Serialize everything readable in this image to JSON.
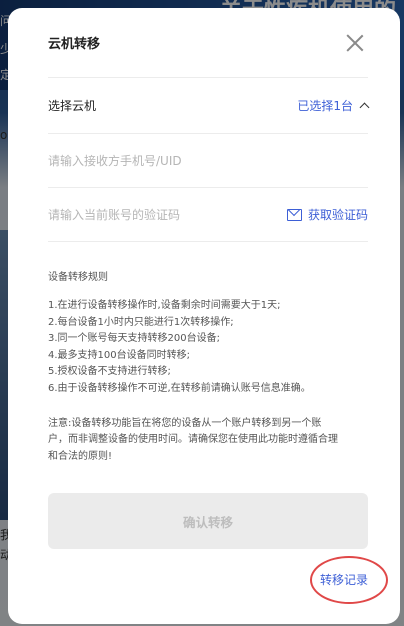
{
  "background": {
    "banner_text": "关于性疾机使用的",
    "left_fragments": [
      "问",
      "少",
      "定",
      "o",
      "我",
      "动"
    ]
  },
  "modal": {
    "title": "云机转移",
    "select_device": {
      "label": "选择云机",
      "value": "已选择1台"
    },
    "phone_input": {
      "placeholder": "请输入接收方手机号/UID",
      "value": ""
    },
    "code_input": {
      "placeholder": "请输入当前账号的验证码",
      "value": ""
    },
    "get_code_label": "获取验证码",
    "rules_title": "设备转移规则",
    "rules": [
      "1.在进行设备转移操作时,设备剩余时间需要大于1天;",
      "2.每台设备1小时内只能进行1次转移操作;",
      "3.同一个账号每天支持转移200台设备;",
      "4.最多支持100台设备同时转移;",
      "5.授权设备不支持进行转移;",
      "6.由于设备转移操作不可逆,在转移前请确认账号信息准确。"
    ],
    "notice_lines": [
      "注意:设备转移功能旨在将您的设备从一个账户转移到另一个账",
      "户，而非调整设备的使用时间。请确保您在使用此功能时遵循合理",
      "和合法的原则!"
    ],
    "confirm_label": "确认转移",
    "record_label": "转移记录"
  },
  "colors": {
    "accent": "#3d5fd6",
    "highlight_circle": "#e04848",
    "disabled_button_bg": "#ebebeb"
  }
}
